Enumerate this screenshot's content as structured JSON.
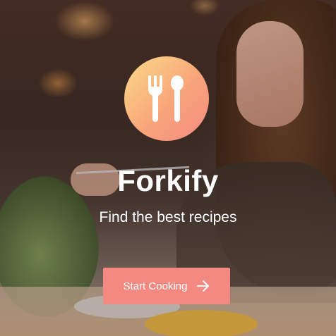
{
  "app": {
    "name": "Forkify",
    "tagline": "Find the best recipes"
  },
  "cta": {
    "label": "Start Cooking",
    "icon": "arrow-right-icon"
  },
  "logo": {
    "icon": "fork-spoon-icon"
  },
  "colors": {
    "gradient_start": "#fbdb89",
    "gradient_end": "#f48982",
    "button": "#f48982",
    "text": "#ffffff"
  }
}
